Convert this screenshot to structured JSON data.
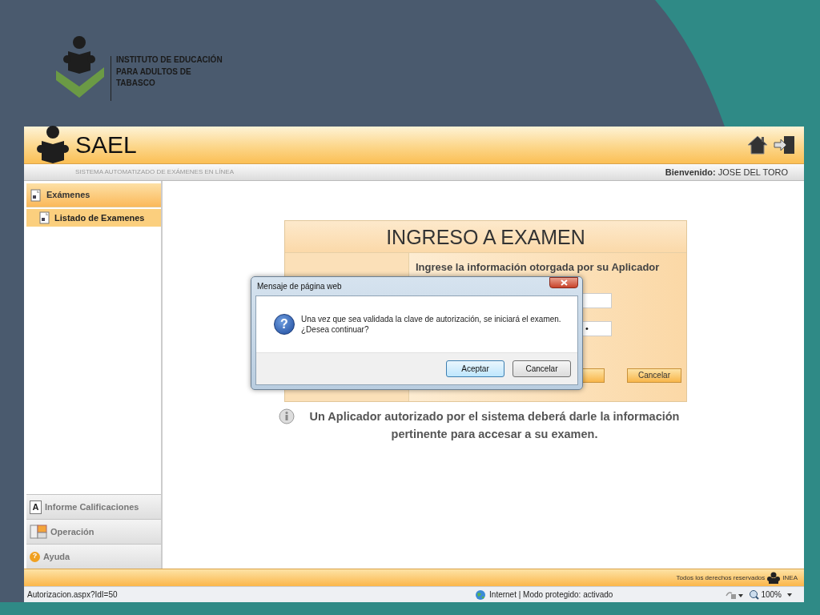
{
  "slide": {
    "organization": "INSTITUTO DE EDUCACIÓN PARA ADULTOS DE TABASCO"
  },
  "app": {
    "title": "SAEL",
    "subtitle": "SISTEMA AUTOMATIZADO DE EXÁMENES EN LÍNEA",
    "welcome": "**Bienvenido:** JOSE DEL TORO"
  },
  "sidebar": {
    "sections": [
      {
        "label": "Exámenes",
        "children": [
          {
            "label": "Listado de Examenes",
            "selected": true
          }
        ]
      }
    ],
    "bottom_items": [
      {
        "label": "Informe Calificaciones",
        "kind": "letter",
        "icon_text": "A"
      },
      {
        "label": "Operación",
        "kind": "panels"
      },
      {
        "label": "Ayuda",
        "kind": "help",
        "icon_text": "?"
      }
    ]
  },
  "form": {
    "title": "INGRESO A EXAMEN",
    "instruction": "Ingrese la información otorgada por su Aplicador",
    "password_value": "•",
    "buttons": [
      {
        "kind": "accept"
      },
      {
        "kind": "cancel",
        "label": "Cancelar"
      }
    ]
  },
  "info": "Un Aplicador autorizado por el sistema deberá darle la información pertinente para accesar a su examen.",
  "dialog": {
    "title": "Mensaje de página web",
    "icon_text": "?",
    "message": [
      "Una vez que sea validada la clave de autorización, se iniciará el examen.",
      "¿Desea continuar?"
    ],
    "buttons": [
      {
        "label": "Aceptar",
        "default": true
      },
      {
        "label": "Cancelar",
        "default": false
      }
    ]
  },
  "footer": {
    "rights": "Todos los derechos reservados",
    "brand": "INEA"
  },
  "status_bar": {
    "url": "Autorizacion.aspx?IdI=50",
    "zone": "Internet | Modo protegido: activado",
    "zoom": "100%"
  }
}
